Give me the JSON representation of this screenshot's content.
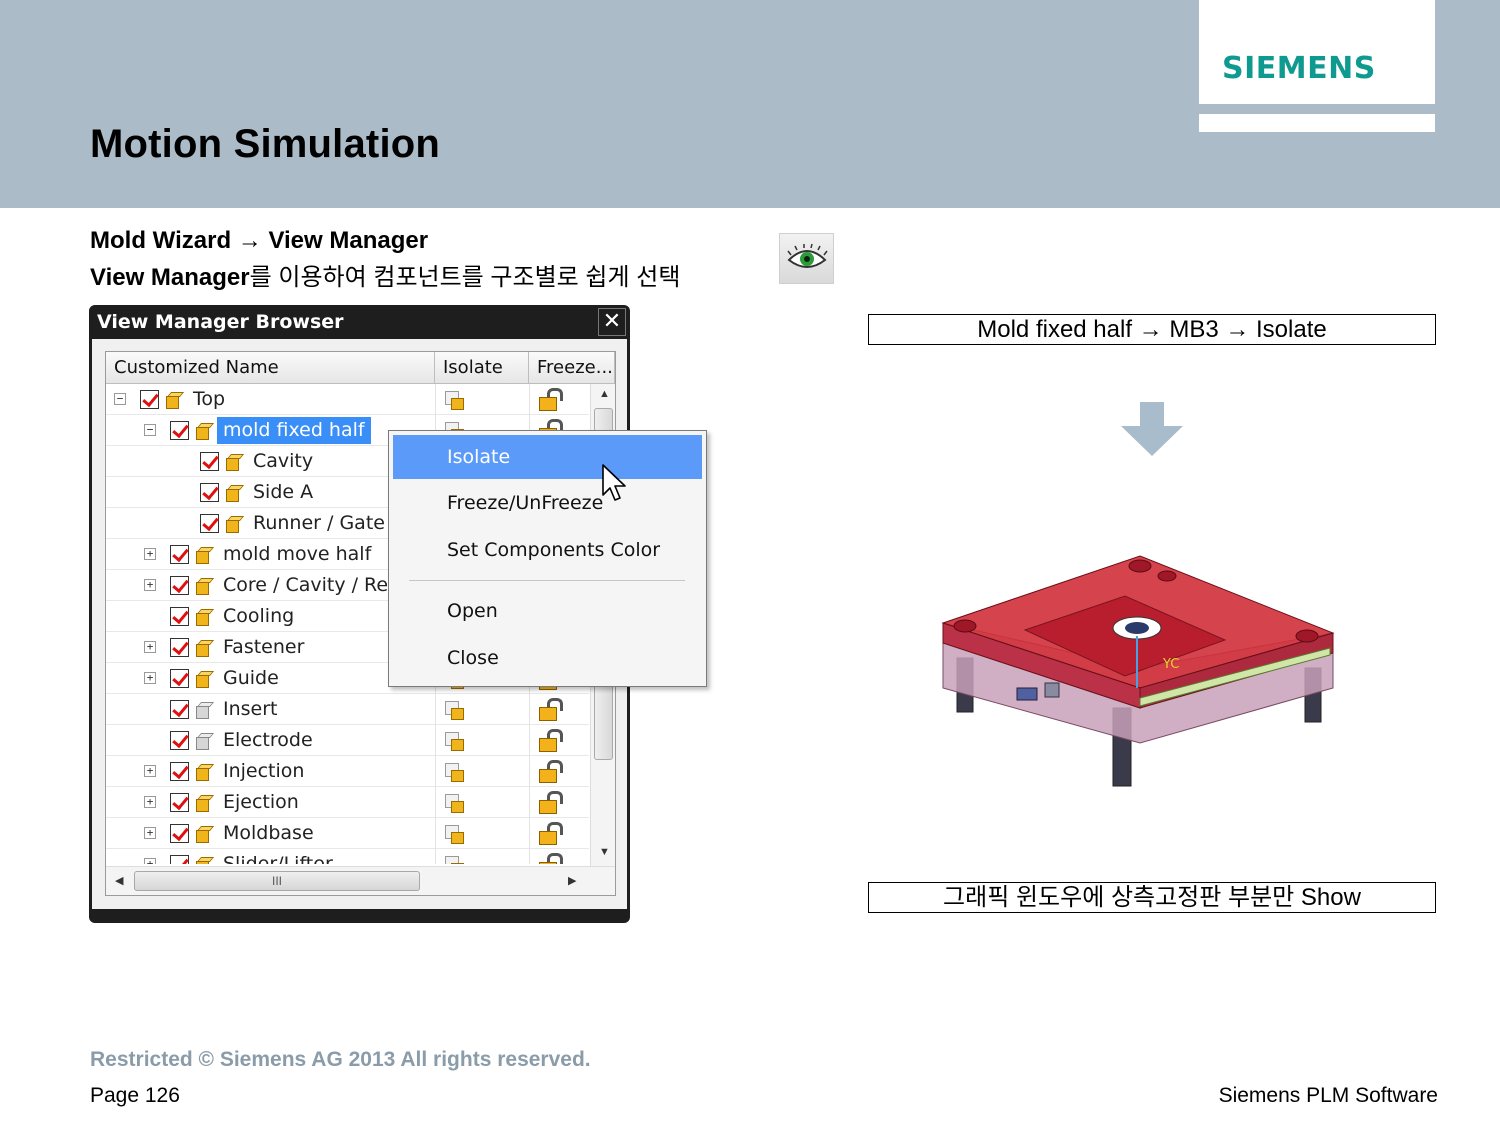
{
  "slide": {
    "title": "Motion Simulation",
    "logo": "SIEMENS",
    "subtitle_line1": "Mold Wizard → View Manager",
    "subtitle_line2_bold": "View Manager",
    "subtitle_line2_rest": "를 이용하여 컴포넌트를 구조별로 쉽게 선택",
    "view_manager_icon": "eye-icon"
  },
  "dialog": {
    "title": "View Manager Browser",
    "close_glyph": "✕",
    "columns": [
      "Customized Name",
      "Isolate",
      "Freeze..."
    ],
    "rows": [
      {
        "label": "Top",
        "level": 0,
        "expander": "−",
        "icon": "assembly"
      },
      {
        "label": "mold fixed half",
        "level": 1,
        "expander": "−",
        "icon": "assembly",
        "selected": true
      },
      {
        "label": "Cavity",
        "level": 2,
        "expander": "",
        "icon": "part"
      },
      {
        "label": "Side A",
        "level": 2,
        "expander": "",
        "icon": "part"
      },
      {
        "label": "Runner / Gate",
        "level": 2,
        "expander": "",
        "icon": "part"
      },
      {
        "label": "mold move half",
        "level": 1,
        "expander": "+",
        "icon": "assembly"
      },
      {
        "label": "Core / Cavity / Re",
        "level": 1,
        "expander": "+",
        "icon": "assembly"
      },
      {
        "label": "Cooling",
        "level": 1,
        "expander": "",
        "icon": "part"
      },
      {
        "label": "Fastener",
        "level": 1,
        "expander": "+",
        "icon": "assembly"
      },
      {
        "label": "Guide",
        "level": 1,
        "expander": "+",
        "icon": "assembly"
      },
      {
        "label": "Insert",
        "level": 1,
        "expander": "",
        "icon": "empty"
      },
      {
        "label": "Electrode",
        "level": 1,
        "expander": "",
        "icon": "empty"
      },
      {
        "label": "Injection",
        "level": 1,
        "expander": "+",
        "icon": "assembly"
      },
      {
        "label": "Ejection",
        "level": 1,
        "expander": "+",
        "icon": "assembly"
      },
      {
        "label": "Moldbase",
        "level": 1,
        "expander": "+",
        "icon": "assembly"
      },
      {
        "label": "Slider/Lifter",
        "level": 1,
        "expander": "+",
        "icon": "assembly"
      }
    ],
    "hscroll_thumb_glyph": "III"
  },
  "context_menu": {
    "items": [
      {
        "label": "Isolate",
        "highlighted": true
      },
      {
        "label": "Freeze/UnFreeze"
      },
      {
        "label": "Set Components Color"
      },
      {
        "label": "Open"
      },
      {
        "label": "Close"
      }
    ]
  },
  "right_panel": {
    "top_label": "Mold fixed half → MB3 → Isolate",
    "bottom_label": "그래픽 윈도우에 상측고정판 부분만 Show",
    "axis_label": "YC"
  },
  "footer": {
    "restricted": "Restricted © Siemens AG 2013 All rights reserved.",
    "page": "Page 126",
    "brand": "Siemens PLM Software"
  },
  "colors": {
    "header_band": "#abbcc8",
    "logo": "#0f9a8f",
    "selection": "#3a8ef7",
    "menu_highlight": "#5b9af9",
    "mold_red": "#d0303a"
  }
}
